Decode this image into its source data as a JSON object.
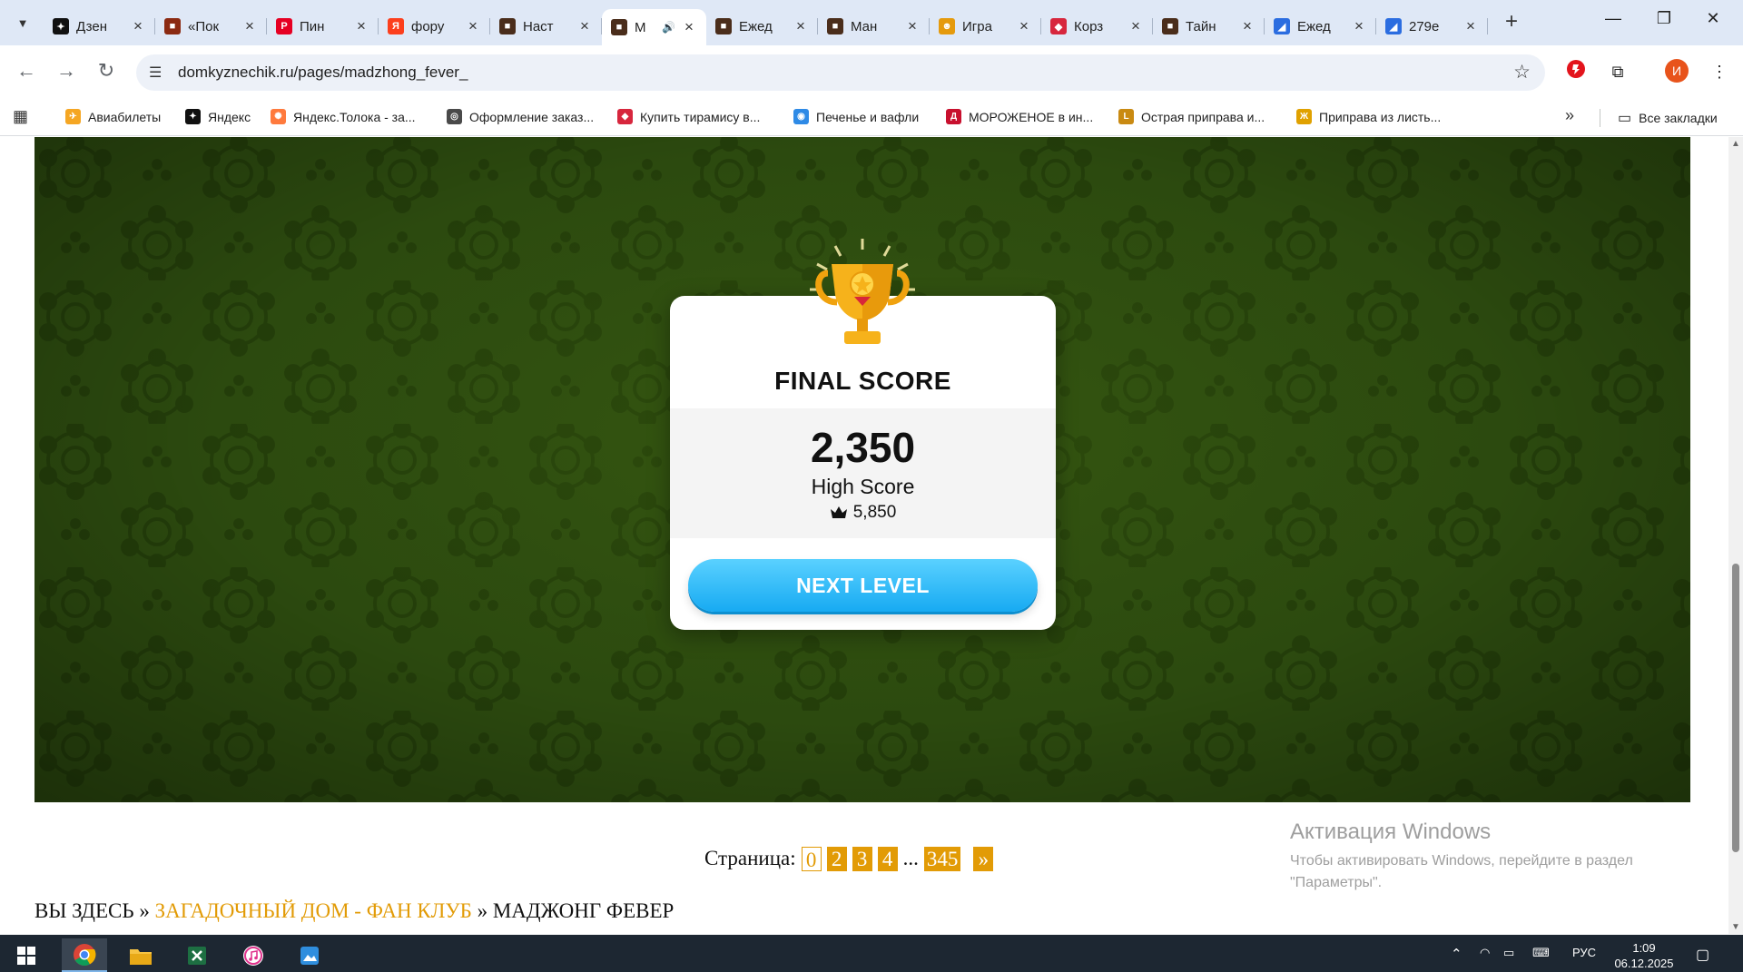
{
  "browser": {
    "tabs": [
      {
        "title": "Дзен",
        "color": "#111111",
        "glyph": "✦"
      },
      {
        "title": "«Пок",
        "color": "#8b2a12",
        "glyph": "■"
      },
      {
        "title": "Пин",
        "color": "#e60023",
        "glyph": "P"
      },
      {
        "title": "фору",
        "color": "#fc3f1d",
        "glyph": "Я"
      },
      {
        "title": "Наст",
        "color": "#4a2d1b",
        "glyph": "■"
      },
      {
        "title": "М",
        "color": "#4a2d1b",
        "glyph": "■",
        "active": true
      },
      {
        "title": "Ежед",
        "color": "#4a2d1b",
        "glyph": "■"
      },
      {
        "title": "Ман",
        "color": "#4a2d1b",
        "glyph": "■"
      },
      {
        "title": "Игра",
        "color": "#e59a0c",
        "glyph": "☻"
      },
      {
        "title": "Корз",
        "color": "#d7263d",
        "glyph": "◆"
      },
      {
        "title": "Тайн",
        "color": "#4a2d1b",
        "glyph": "■"
      },
      {
        "title": "Ежед",
        "color": "#2b6de0",
        "glyph": "◢"
      },
      {
        "title": "279e",
        "color": "#2b6de0",
        "glyph": "◢"
      }
    ],
    "url": "domkyznechik.ru/pages/madzhong_fever_",
    "avatar_letter": "И",
    "bookmarks": [
      {
        "label": "Авиабилеты",
        "color": "#f5a623",
        "glyph": "✈"
      },
      {
        "label": "Яндекс",
        "color": "#111111",
        "glyph": "✦"
      },
      {
        "label": "Яндекс.Толока - за...",
        "color": "#ff7a3d",
        "glyph": "✺"
      },
      {
        "label": "Оформление заказ...",
        "color": "#4a4a4a",
        "glyph": "◎"
      },
      {
        "label": "Купить тирамису в...",
        "color": "#d7263d",
        "glyph": "◆"
      },
      {
        "label": "Печенье и вафли",
        "color": "#2e8ae6",
        "glyph": "◉"
      },
      {
        "label": "МОРОЖЕНОЕ в ин...",
        "color": "#c8102e",
        "glyph": "Д"
      },
      {
        "label": "Острая приправа и...",
        "color": "#c98a12",
        "glyph": "L"
      },
      {
        "label": "Приправа из листь...",
        "color": "#e0a100",
        "glyph": "Ж"
      }
    ],
    "all_bookmarks": "Все закладки"
  },
  "game": {
    "title": "FINAL SCORE",
    "score": "2,350",
    "high_score_label": "High Score",
    "high_score_value": "5,850",
    "next_button": "NEXT LEVEL"
  },
  "pager": {
    "label": "Страница:",
    "pages": [
      "0",
      "2",
      "3",
      "4"
    ],
    "ellipsis": "...",
    "last": "345",
    "next": "»"
  },
  "breadcrumbs": {
    "prefix": "ВЫ ЗДЕСЬ",
    "sep": "»",
    "link": "ЗАГАДОЧНЫЙ ДОМ - ФАН КЛУБ",
    "current": "МАДЖОНГ ФЕВЕР"
  },
  "activation": {
    "title": "Активация Windows",
    "line1": "Чтобы активировать Windows, перейдите в раздел",
    "line2": "\"Параметры\"."
  },
  "taskbar": {
    "lang": "РУС",
    "time": "1:09",
    "date": "06.12.2025"
  }
}
